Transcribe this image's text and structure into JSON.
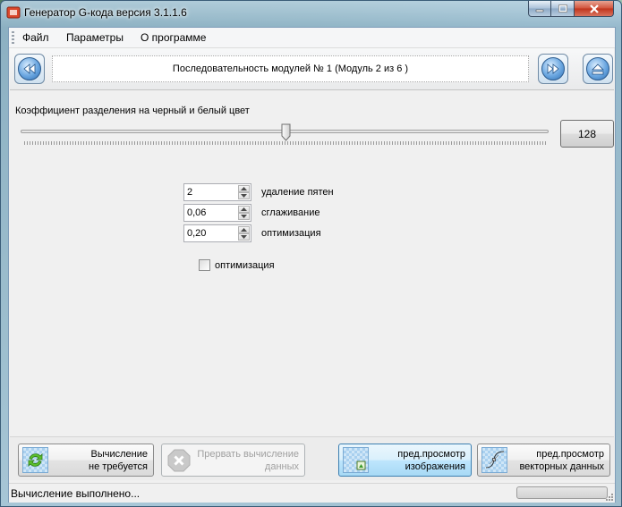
{
  "window": {
    "title": "Генератор G-кода версия 3.1.1.6",
    "controls": {
      "minimize": "—",
      "maximize": "□",
      "close": "✕"
    }
  },
  "menu": {
    "items": [
      {
        "label": "Файл"
      },
      {
        "label": "Параметры"
      },
      {
        "label": "О программе"
      }
    ]
  },
  "navigation": {
    "prev_icon": "rewind-icon",
    "next_icon": "fast-forward-icon",
    "eject_icon": "eject-icon",
    "sequence_label": "Последовательность модулей № 1 (Модуль 2 из 6 )"
  },
  "threshold": {
    "label": "Коэффициент разделения на черный и белый цвет",
    "value": "128",
    "min": 0,
    "max": 255,
    "slider_value": 128
  },
  "parameters": [
    {
      "value": "2",
      "label": "удаление пятен"
    },
    {
      "value": "0,06",
      "label": "сглаживание"
    },
    {
      "value": "0,20",
      "label": "оптимизация"
    }
  ],
  "optimize_checkbox": {
    "label": "оптимизация",
    "checked": false
  },
  "actions": {
    "compute": {
      "line1": "Вычисление",
      "line2": "не требуется",
      "icon": "refresh-icon"
    },
    "abort": {
      "line1": "Прервать вычисление",
      "line2": "данных",
      "icon": "stop-icon"
    },
    "preview_image": {
      "line1": "пред.просмотр",
      "line2": "изображения",
      "icon": "image-preview-icon"
    },
    "preview_vector": {
      "line1": "пред.просмотр",
      "line2": "векторных данных",
      "icon": "vector-preview-icon"
    }
  },
  "status": {
    "text": "Вычисление выполнено...",
    "progress": 0
  },
  "colors": {
    "accent": "#2f6fb3",
    "active_button": "#bee6fd",
    "progress_fill": "#5fc94c"
  }
}
